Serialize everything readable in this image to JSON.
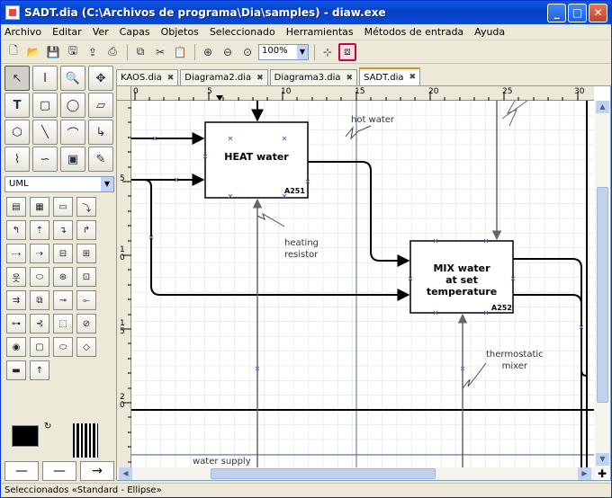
{
  "window": {
    "title": "SADT.dia (C:\\Archivos de programa\\Dia\\samples) - diaw.exe",
    "controls": [
      "_",
      "□",
      "✕"
    ]
  },
  "menu": [
    "Archivo",
    "Editar",
    "Ver",
    "Capas",
    "Objetos",
    "Seleccionado",
    "Herramientas",
    "Métodos de entrada",
    "Ayuda"
  ],
  "toolbar": {
    "zoom": "100%",
    "icons": [
      "new-icon",
      "open-icon",
      "save-icon",
      "save-as-icon",
      "export-icon",
      "print-icon",
      "copy-icon",
      "cut-icon",
      "paste-icon",
      "zoom-in-icon",
      "zoom-out-icon",
      "zoom-fit-icon",
      "snap-grid-icon",
      "magnet-icon"
    ]
  },
  "toolbox": {
    "sheet": "UML"
  },
  "tabs": [
    {
      "label": "KAOS.dia",
      "active": false
    },
    {
      "label": "Diagrama2.dia",
      "active": false
    },
    {
      "label": "Diagrama3.dia",
      "active": false
    },
    {
      "label": "SADT.dia",
      "active": true
    }
  ],
  "ruler": {
    "h": [
      "0",
      "5",
      "10",
      "15",
      "20",
      "25",
      "30"
    ],
    "v": [
      "5",
      "1\n0",
      "1\n5",
      "2\n0"
    ]
  },
  "diagram": {
    "boxes": [
      {
        "title": "HEAT water",
        "id": "A251"
      },
      {
        "title": "MIX water\nat set\ntemperature",
        "id": "A252"
      }
    ],
    "labels": {
      "hot_water": "hot water",
      "heating_resistor": "heating\nresistor",
      "thermostatic_mixer": "thermostatic\nmixer",
      "water_supply": "water supply"
    }
  },
  "status": "Seleccionados «Standard - Ellipse»"
}
